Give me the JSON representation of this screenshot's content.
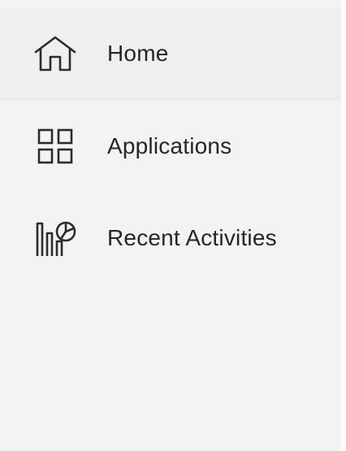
{
  "sidebar": {
    "items": [
      {
        "label": "Home",
        "icon": "home-icon",
        "active": true
      },
      {
        "label": "Applications",
        "icon": "apps-grid-icon",
        "active": false
      },
      {
        "label": "Recent Activities",
        "icon": "activity-chart-icon",
        "active": false
      }
    ]
  },
  "colors": {
    "panel_background": "#f3f3f3",
    "text": "#262626",
    "icon_stroke": "#2b2b2b"
  }
}
